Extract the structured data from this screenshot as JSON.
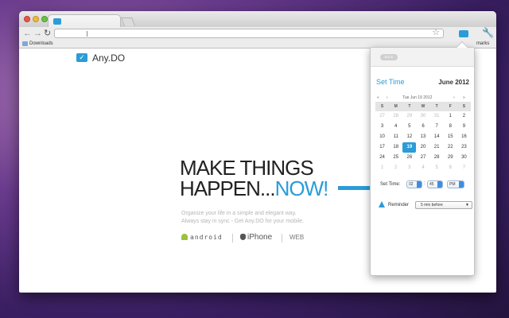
{
  "browser": {
    "bookmarks": {
      "downloads": "Downloads",
      "other": "marks"
    }
  },
  "page": {
    "logo": "Any.DO",
    "headline_line1": "MAKE THINGS",
    "headline_line2a": "HAPPEN...",
    "headline_line2b": "NOW!",
    "sub_line1": "Organize your life in a simple and elegant way.",
    "sub_line2": "Always stay in sync - Get Any.DO for your mobile.",
    "platforms": {
      "android": "android",
      "iphone": "iPhone",
      "web": "WEB"
    }
  },
  "popup": {
    "back": "BACK",
    "title": "Set Time",
    "month": "June 2012",
    "nav": {
      "prev2": "«",
      "prev": "‹",
      "date": "Tue Jun 19 2012",
      "next": "›",
      "next2": "»"
    },
    "dow": [
      "S",
      "M",
      "T",
      "W",
      "T",
      "F",
      "S"
    ],
    "days": [
      {
        "d": "27",
        "m": true
      },
      {
        "d": "28",
        "m": true
      },
      {
        "d": "29",
        "m": true
      },
      {
        "d": "30",
        "m": true
      },
      {
        "d": "31",
        "m": true
      },
      {
        "d": "1"
      },
      {
        "d": "2"
      },
      {
        "d": "3"
      },
      {
        "d": "4"
      },
      {
        "d": "5"
      },
      {
        "d": "6"
      },
      {
        "d": "7"
      },
      {
        "d": "8"
      },
      {
        "d": "9"
      },
      {
        "d": "10"
      },
      {
        "d": "11"
      },
      {
        "d": "12"
      },
      {
        "d": "13"
      },
      {
        "d": "14"
      },
      {
        "d": "15"
      },
      {
        "d": "16"
      },
      {
        "d": "17"
      },
      {
        "d": "18"
      },
      {
        "d": "19",
        "s": true
      },
      {
        "d": "20"
      },
      {
        "d": "21"
      },
      {
        "d": "22"
      },
      {
        "d": "23"
      },
      {
        "d": "24"
      },
      {
        "d": "25"
      },
      {
        "d": "26"
      },
      {
        "d": "27"
      },
      {
        "d": "28"
      },
      {
        "d": "29"
      },
      {
        "d": "30"
      },
      {
        "d": "1",
        "m": true
      },
      {
        "d": "2",
        "m": true
      },
      {
        "d": "3",
        "m": true
      },
      {
        "d": "4",
        "m": true
      },
      {
        "d": "5",
        "m": true
      },
      {
        "d": "6",
        "m": true
      },
      {
        "d": "7",
        "m": true
      }
    ],
    "set_time_label": "Set Time:",
    "hour": "02",
    "minute": "45",
    "ampm": "PM",
    "reminder_label": "Reminder",
    "reminder_value": "5 min before"
  },
  "colors": {
    "accent": "#2a9cd8"
  }
}
